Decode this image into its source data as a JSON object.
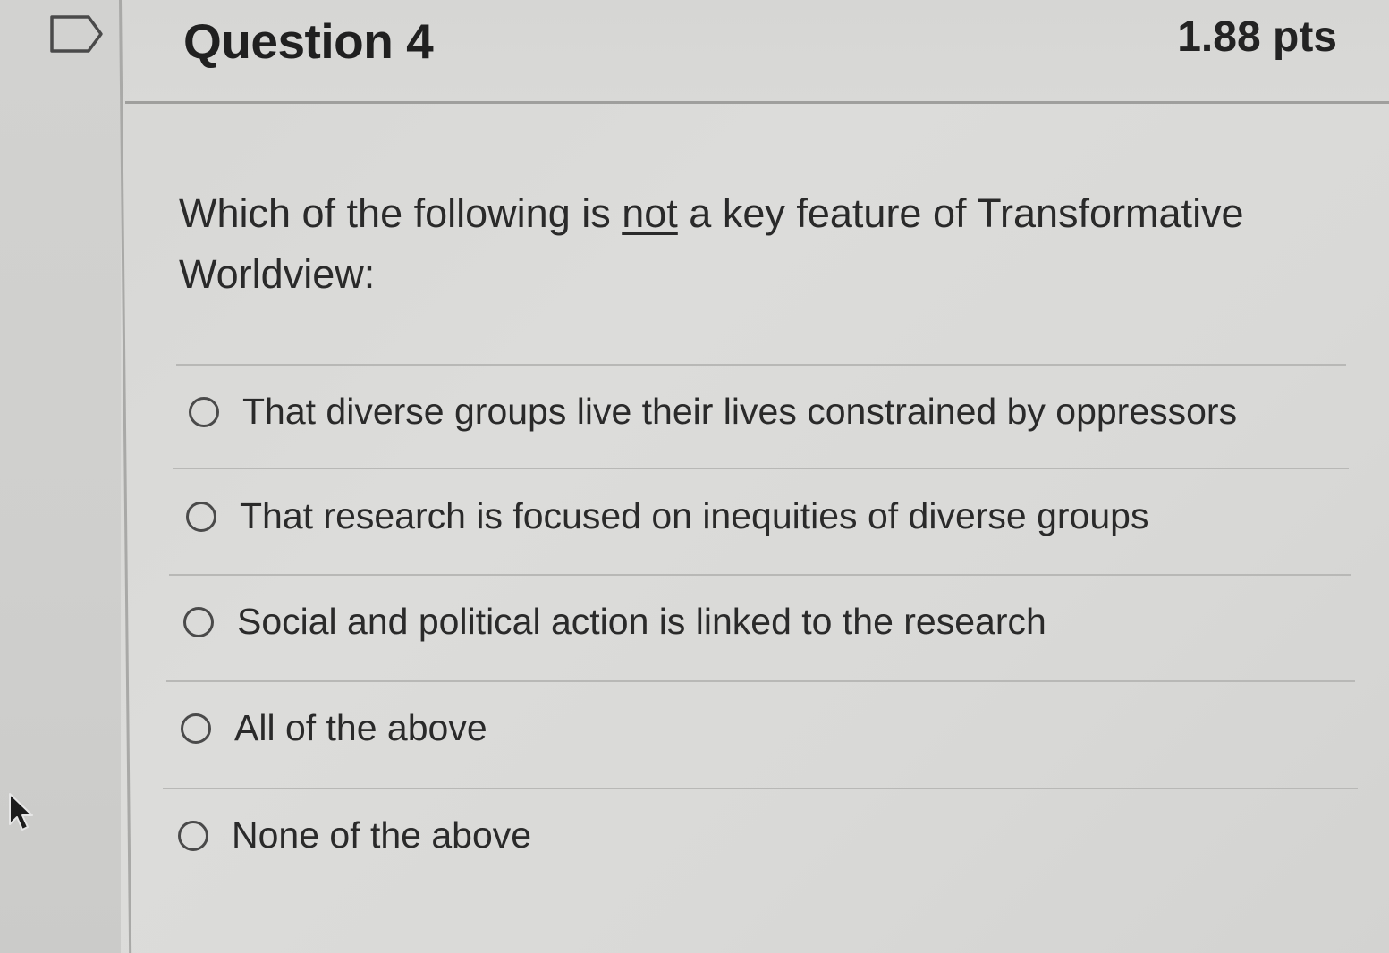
{
  "question": {
    "title": "Question 4",
    "points": "1.88 pts",
    "text_before": "Which of the following is ",
    "text_emphasis": "not",
    "text_after": " a key feature of Transformative Worldview:"
  },
  "options": [
    {
      "label": "That diverse groups live their lives constrained by oppressors",
      "selected": false
    },
    {
      "label": "That research is focused on inequities of diverse groups",
      "selected": false
    },
    {
      "label": "Social and political action is linked to the research",
      "selected": false
    },
    {
      "label": "All of the above",
      "selected": false
    },
    {
      "label": "None of the above",
      "selected": false
    }
  ],
  "icons": {
    "flag": "flag-icon",
    "cursor": "cursor-icon",
    "radio": "radio-icon"
  }
}
